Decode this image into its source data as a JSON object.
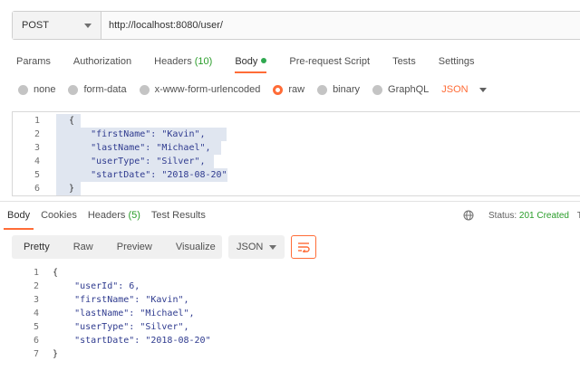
{
  "request": {
    "method": "POST",
    "url": "http://localhost:8080/user/"
  },
  "tabs": [
    {
      "label": "Params"
    },
    {
      "label": "Authorization"
    },
    {
      "label": "Headers",
      "count": "(10)"
    },
    {
      "label": "Body"
    },
    {
      "label": "Pre-request Script"
    },
    {
      "label": "Tests"
    },
    {
      "label": "Settings"
    }
  ],
  "body_types": {
    "none": "none",
    "form_data": "form-data",
    "urlencoded": "x-www-form-urlencoded",
    "raw": "raw",
    "binary": "binary",
    "graphql": "GraphQL",
    "format": "JSON",
    "selected": "raw"
  },
  "request_body": {
    "line_numbers": [
      "1",
      "2",
      "3",
      "4",
      "5",
      "6"
    ],
    "lines": [
      "{",
      "    \"firstName\": \"Kavin\",",
      "    \"lastName\": \"Michael\",",
      "    \"userType\": \"Silver\",",
      "    \"startDate\": \"2018-08-20\"",
      "}"
    ]
  },
  "response_tabs": [
    {
      "label": "Body"
    },
    {
      "label": "Cookies"
    },
    {
      "label": "Headers",
      "count": "(5)"
    },
    {
      "label": "Test Results"
    }
  ],
  "status": {
    "label": "Status:",
    "value": "201 Created",
    "time_prefix": "T"
  },
  "response_toolbar": {
    "pretty": "Pretty",
    "raw": "Raw",
    "preview": "Preview",
    "visualize": "Visualize",
    "format": "JSON"
  },
  "response_body": {
    "line_numbers": [
      "1",
      "2",
      "3",
      "4",
      "5",
      "6",
      "7"
    ],
    "lines": [
      "{",
      "    \"userId\": 6,",
      "    \"firstName\": \"Kavin\",",
      "    \"lastName\": \"Michael\",",
      "    \"userType\": \"Silver\",",
      "    \"startDate\": \"2018-08-20\"",
      "}"
    ]
  },
  "colors": {
    "accent": "#ff6c37",
    "success": "#2a9d2a",
    "selection": "#e0e6f0"
  }
}
